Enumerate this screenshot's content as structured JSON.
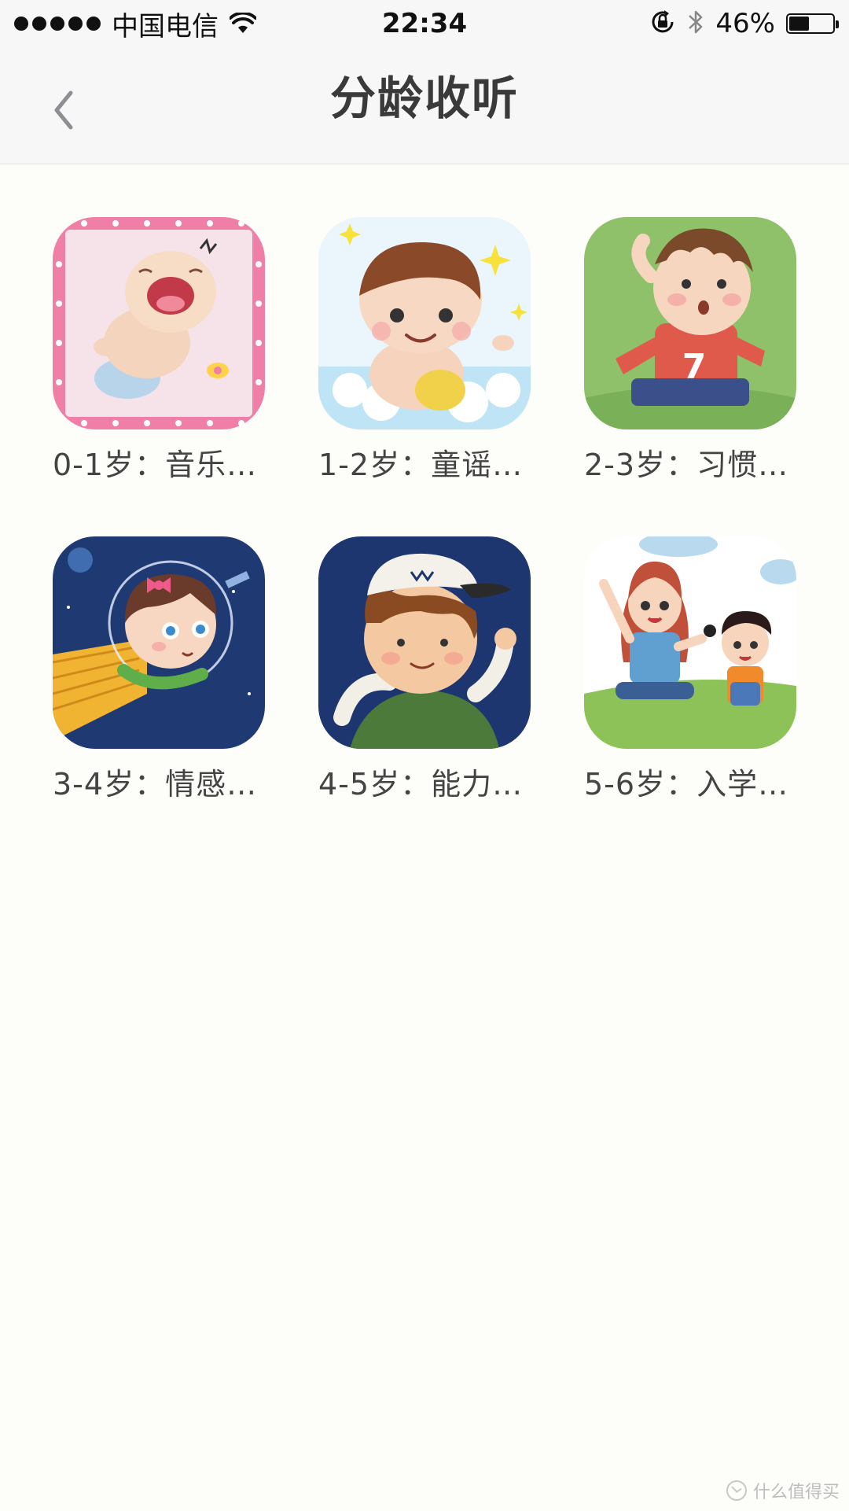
{
  "status_bar": {
    "carrier": "中国电信",
    "time": "22:34",
    "battery_percent": "46%",
    "battery_level": 0.46,
    "icons": [
      "signal-dots-icon",
      "wifi-icon",
      "rotation-lock-icon",
      "bluetooth-icon",
      "battery-icon"
    ]
  },
  "nav": {
    "title": "分龄收听",
    "back_icon": "chevron-left-icon"
  },
  "grid": {
    "items": [
      {
        "label": "0-1岁：音乐…",
        "cover": "crying-baby"
      },
      {
        "label": "1-2岁：童谣…",
        "cover": "bathing-boy"
      },
      {
        "label": "2-3岁：习惯…",
        "cover": "boy-red-jersey"
      },
      {
        "label": "3-4岁：情感…",
        "cover": "space-girl"
      },
      {
        "label": "4-5岁：能力…",
        "cover": "boy-cap"
      },
      {
        "label": "5-6岁：入学…",
        "cover": "mother-and-child"
      }
    ]
  },
  "watermark": {
    "text": "什么值得买"
  },
  "colors": {
    "background": "#fdfdf9",
    "nav_background": "#f7f7f8",
    "title_text": "#3a3a3a",
    "label_text": "#444444"
  }
}
